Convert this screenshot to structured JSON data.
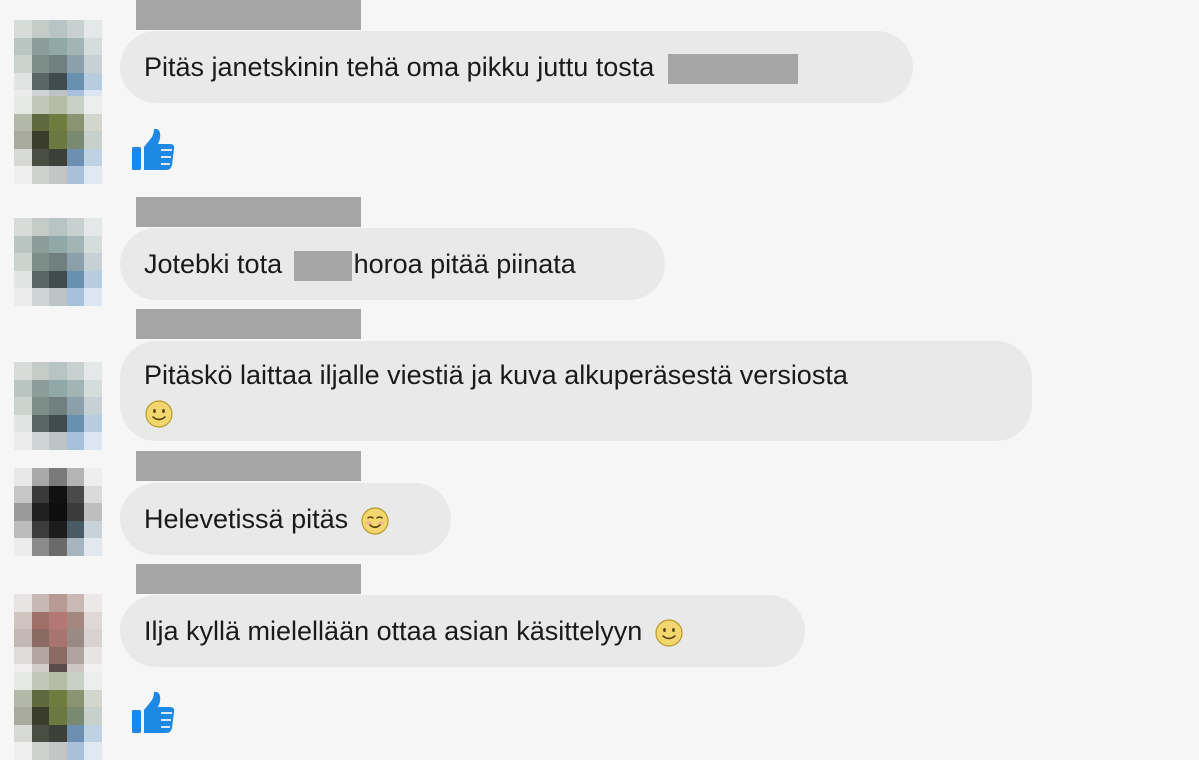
{
  "messages": [
    {
      "text": "Pitäs janetskinin tehä oma pikku juttu tosta",
      "has_redaction": true,
      "emoji": null
    },
    {
      "text_before": "Jotebki tota",
      "text_after": "horoa pitää piinata",
      "emoji": null
    },
    {
      "line1": "Pitäskö laittaa iljalle viestiä ja kuva alkuperäsestä versiosta",
      "emoji": "slightly-smiling-face"
    },
    {
      "text": "Helevetissä pitäs",
      "emoji": "smiling-face"
    },
    {
      "text": "Ilja kyllä mielellään ottaa asian käsittelyyn",
      "emoji": "slightly-smiling-face"
    }
  ],
  "reactions": [
    "thumbs-up-icon",
    "thumbs-up-icon"
  ],
  "colors": {
    "background": "#f6f6f6",
    "bubble": "#e9e9e9",
    "redaction": "#a5a5a5",
    "like_blue": "#1e88e5",
    "emoji_yellow": "#f3d66d"
  }
}
